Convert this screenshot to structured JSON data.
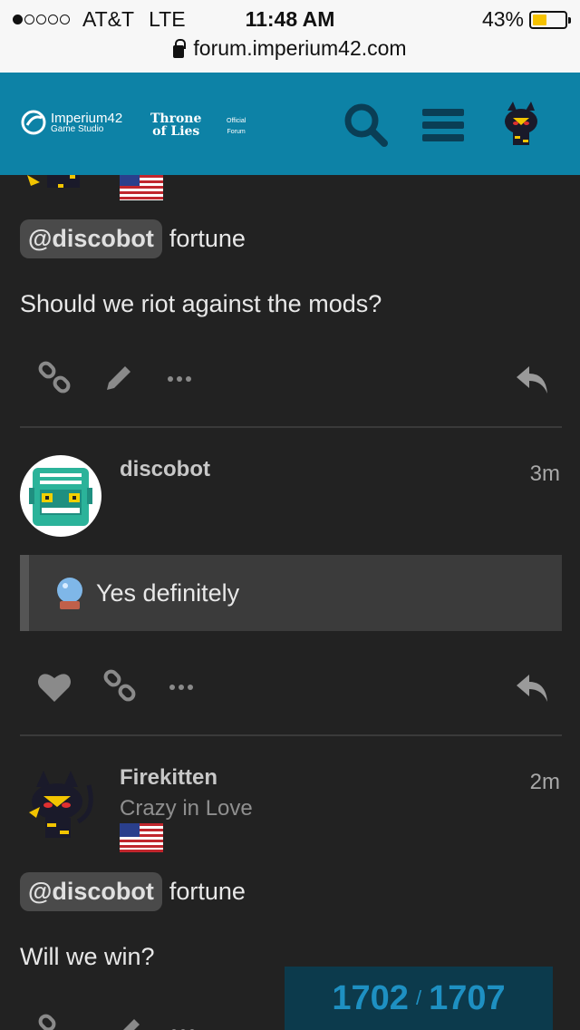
{
  "status_bar": {
    "carrier": "AT&T",
    "network": "LTE",
    "time": "11:48 AM",
    "battery": "43%",
    "battery_level": 0.43,
    "url": "forum.imperium42.com"
  },
  "header": {
    "logo_line1": "Imperium42",
    "logo_line2": "Game Studio",
    "tol_line1": "Throne",
    "tol_line2": "of Lies",
    "official_line1": "Official",
    "official_line2": "Forum",
    "colors": {
      "bar": "#0d82a6",
      "icons": "#0a3e55"
    }
  },
  "posts": [
    {
      "mention": "@discobot",
      "command": "fortune",
      "body": "Should we riot against the mods?"
    },
    {
      "username": "discobot",
      "time": "3m",
      "quote_text": "Yes definitely"
    },
    {
      "username": "Firekitten",
      "user_title": "Crazy in Love",
      "time": "2m",
      "mention": "@discobot",
      "command": "fortune",
      "body": "Will we win?"
    }
  ],
  "progress": {
    "current": "1702",
    "separator": "/",
    "total": "1707"
  }
}
